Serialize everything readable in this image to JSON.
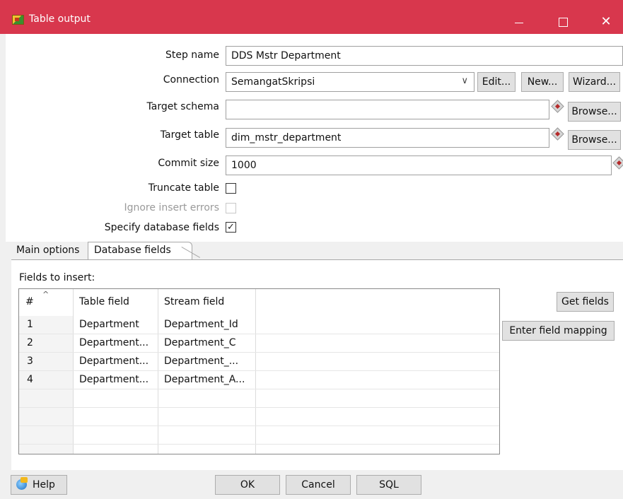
{
  "window": {
    "title": "Table output",
    "controls": {
      "minimize": "minimize-icon",
      "maximize": "maximize-icon",
      "close": "✕"
    }
  },
  "form": {
    "step_name_label": "Step name",
    "step_name_value": "DDS Mstr Department",
    "connection_label": "Connection",
    "connection_value": "SemangatSkripsi",
    "edit_button": "Edit...",
    "new_button": "New...",
    "wizard_button": "Wizard...",
    "target_schema_label": "Target schema",
    "target_schema_value": "",
    "browse_schema_button": "Browse...",
    "target_table_label": "Target table",
    "target_table_value": "dim_mstr_department",
    "browse_table_button": "Browse...",
    "commit_size_label": "Commit size",
    "commit_size_value": "1000",
    "truncate_table_label": "Truncate table",
    "truncate_table_checked": false,
    "ignore_errors_label": "Ignore insert errors",
    "ignore_errors_checked": false,
    "specify_fields_label": "Specify database fields",
    "specify_fields_checked": true
  },
  "tabs": {
    "main_options": "Main options",
    "database_fields": "Database fields",
    "active": "Database fields"
  },
  "fields_panel": {
    "label": "Fields to insert:",
    "columns": [
      "#",
      "Table field",
      "Stream field"
    ],
    "rows": [
      {
        "num": "1",
        "table_field": "Department",
        "stream_field": "Department_Id"
      },
      {
        "num": "2",
        "table_field": "Department...",
        "stream_field": "Department_C"
      },
      {
        "num": "3",
        "table_field": "Department...",
        "stream_field": "Department_..."
      },
      {
        "num": "4",
        "table_field": "Department...",
        "stream_field": "Department_A..."
      }
    ],
    "get_fields_button": "Get fields",
    "enter_mapping_button": "Enter field mapping"
  },
  "bottom": {
    "help_button": "Help",
    "ok_button": "OK",
    "cancel_button": "Cancel",
    "sql_button": "SQL"
  },
  "colors": {
    "titlebar": "#d8374d",
    "window_bg": "#f0f0f0",
    "button_bg": "#e1e1e1"
  },
  "icons": {
    "app": "pentaho-spoon-icon",
    "variable": "variable-diamond-icon",
    "help": "help-globe-icon"
  }
}
